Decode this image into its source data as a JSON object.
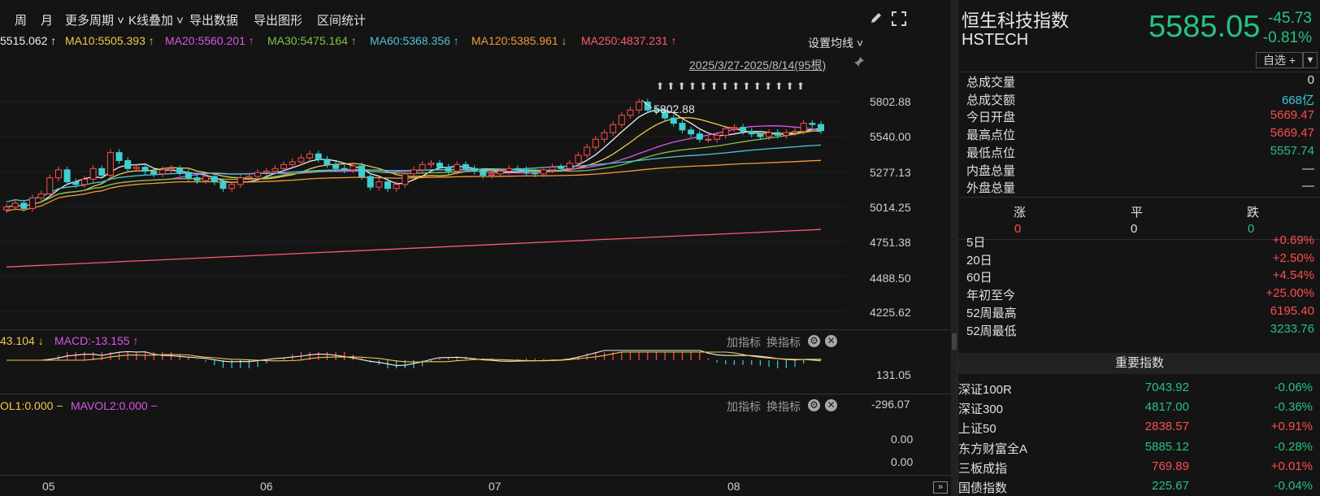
{
  "toolbar": {
    "items": [
      "周",
      "月",
      "更多周期 ˅",
      "K线叠加 ˅",
      "导出数据",
      "导出图形",
      "区间统计"
    ],
    "draw_icon": "pencil-icon",
    "fullscreen_icon": "expand-icon"
  },
  "ma_legend": [
    {
      "text": "5515.062 ↑",
      "color": "#f0f0f0"
    },
    {
      "text": "MA10:5505.393 ↑",
      "color": "#f2c94c"
    },
    {
      "text": "MA20:5560.201 ↑",
      "color": "#d957e8"
    },
    {
      "text": "MA30:5475.164 ↑",
      "color": "#7ec24a"
    },
    {
      "text": "MA60:5368.356 ↑",
      "color": "#4fc3d9"
    },
    {
      "text": "MA120:5385.961 ↓",
      "color": "#f59a3c"
    },
    {
      "text": "MA250:4837.231 ↑",
      "color": "#ff5a6e"
    }
  ],
  "settings_ma_label": "设置均线 ˅",
  "range_label": "2025/3/27-2025/8/14(95根)",
  "high_marker": "5802.88",
  "price_axis": [
    "5802.88",
    "5540.00",
    "5277.13",
    "5014.25",
    "4751.38",
    "4488.50",
    "4225.62"
  ],
  "macd": {
    "header": [
      {
        "text": "43.104 ↓",
        "color": "#f2c94c"
      },
      {
        "text": "MACD:-13.155 ↑",
        "color": "#d957e8"
      }
    ],
    "axis": [
      "131.05",
      "-296.07"
    ]
  },
  "vol": {
    "header": [
      {
        "text": "OL1:0.000 −",
        "color": "#f2c94c"
      },
      {
        "text": "MAVOL2:0.000 −",
        "color": "#d957e8"
      }
    ],
    "axis": [
      "0.00",
      "0.00"
    ]
  },
  "indicator_controls": {
    "add": "加指标",
    "switch": "换指标"
  },
  "x_axis": [
    "05",
    "06",
    "07",
    "08"
  ],
  "quote": {
    "name": "恒生科技指数",
    "code": "HSTECH",
    "price": "5585.05",
    "change": "-45.73",
    "change_pct": "-0.81%",
    "watch_label": "自选 +",
    "stats": [
      {
        "label": "总成交量",
        "value": "0",
        "color": "white"
      },
      {
        "label": "总成交额",
        "value": "668亿",
        "color": "cyan"
      },
      {
        "label": "今日开盘",
        "value": "5669.47",
        "color": "red"
      },
      {
        "label": "最高点位",
        "value": "5669.47",
        "color": "red"
      },
      {
        "label": "最低点位",
        "value": "5557.74",
        "color": "green"
      },
      {
        "label": "内盘总量",
        "value": "—",
        "color": "white"
      },
      {
        "label": "外盘总量",
        "value": "—",
        "color": "white"
      }
    ],
    "updown": {
      "labels": [
        "涨",
        "平",
        "跌"
      ],
      "values": [
        "0",
        "0",
        "0"
      ]
    },
    "perf": [
      {
        "label": "5日",
        "value": "+0.69%",
        "color": "red"
      },
      {
        "label": "20日",
        "value": "+2.50%",
        "color": "red"
      },
      {
        "label": "60日",
        "value": "+4.54%",
        "color": "red"
      },
      {
        "label": "年初至今",
        "value": "+25.00%",
        "color": "red"
      },
      {
        "label": "52周最高",
        "value": "6195.40",
        "color": "red"
      },
      {
        "label": "52周最低",
        "value": "3233.76",
        "color": "green"
      }
    ]
  },
  "indices": {
    "header": "重要指数",
    "rows": [
      {
        "name": "深证100R",
        "price": "7043.92",
        "change": "-0.06%",
        "color": "green"
      },
      {
        "name": "深证300",
        "price": "4817.00",
        "change": "-0.36%",
        "color": "green"
      },
      {
        "name": "上证50",
        "price": "2838.57",
        "change": "+0.91%",
        "color": "red"
      },
      {
        "name": "东方财富全A",
        "price": "5885.12",
        "change": "-0.28%",
        "color": "green"
      },
      {
        "name": "三板成指",
        "price": "769.89",
        "change": "+0.01%",
        "color": "red"
      },
      {
        "name": "国债指数",
        "price": "225.67",
        "change": "-0.04%",
        "color": "green"
      }
    ]
  },
  "chart_data": {
    "type": "candlestick",
    "price_axis_range": [
      4225.62,
      5802.88
    ],
    "high_label": 5802.88,
    "closes": [
      5010,
      5040,
      5000,
      5080,
      5110,
      5230,
      5290,
      5200,
      5180,
      5220,
      5300,
      5250,
      5420,
      5360,
      5300,
      5310,
      5280,
      5260,
      5290,
      5300,
      5270,
      5230,
      5210,
      5240,
      5200,
      5150,
      5180,
      5230,
      5240,
      5270,
      5280,
      5300,
      5330,
      5350,
      5380,
      5410,
      5370,
      5330,
      5300,
      5290,
      5320,
      5240,
      5160,
      5200,
      5150,
      5180,
      5260,
      5290,
      5330,
      5340,
      5310,
      5280,
      5330,
      5300,
      5280,
      5250,
      5260,
      5280,
      5300,
      5290,
      5270,
      5260,
      5290,
      5310,
      5300,
      5340,
      5400,
      5460,
      5520,
      5570,
      5630,
      5700,
      5740,
      5800,
      5740,
      5730,
      5680,
      5640,
      5590,
      5560,
      5520,
      5520,
      5550,
      5600,
      5610,
      5580,
      5560,
      5540,
      5570,
      5550,
      5570,
      5580,
      5640,
      5631,
      5585
    ]
  }
}
